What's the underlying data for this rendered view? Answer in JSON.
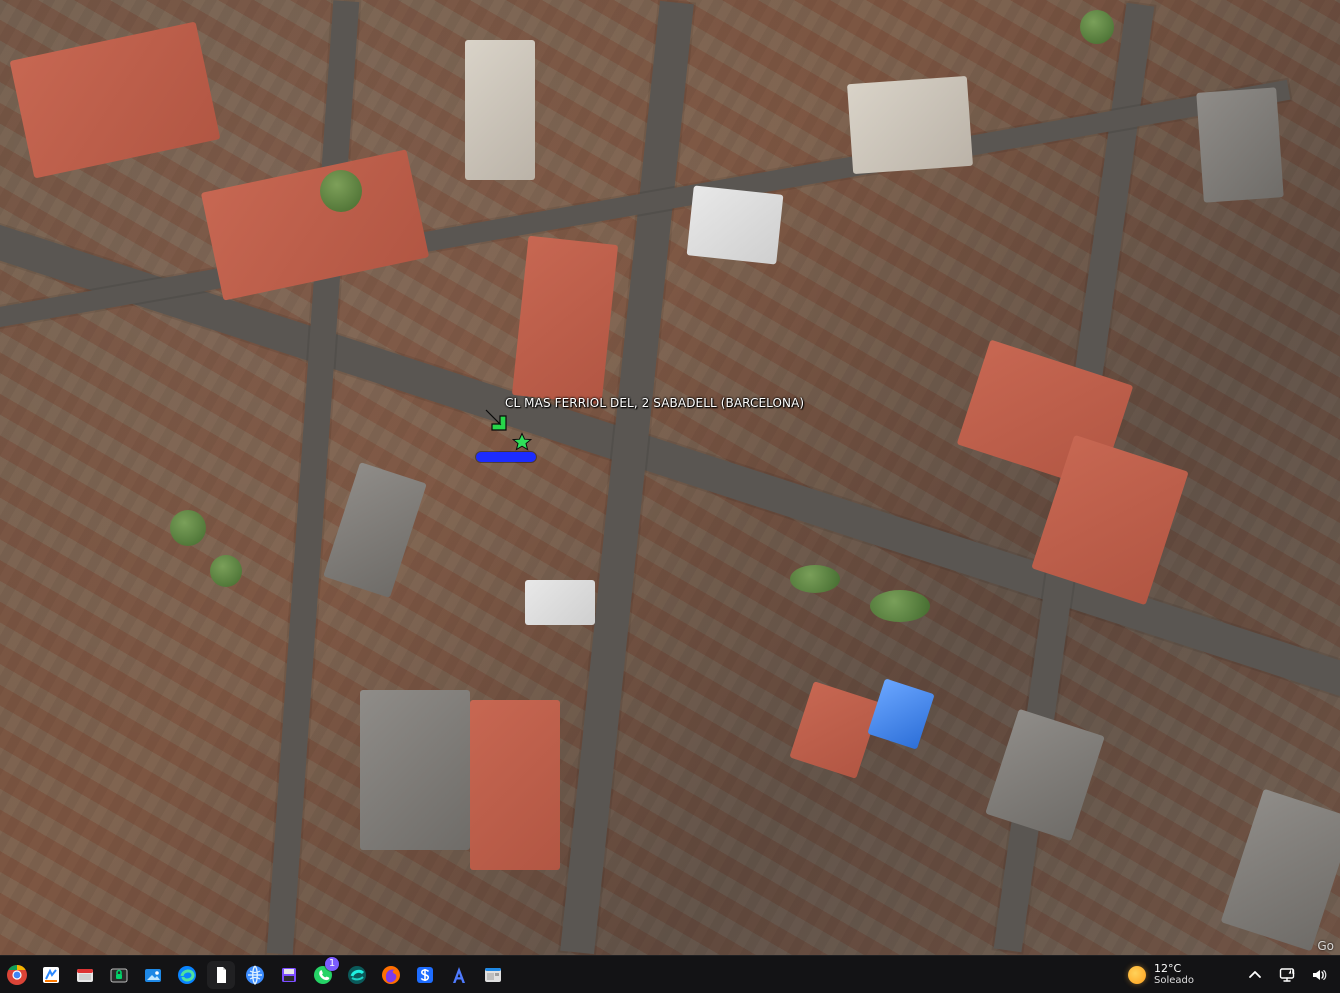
{
  "map": {
    "location_label": "CL MAS FERRIOL DEL, 2  SABADELL (BARCELONA)",
    "attribution_partial": "Go"
  },
  "taskbar": {
    "apps": [
      {
        "name": "chrome-icon",
        "badge": ""
      },
      {
        "name": "whiteboard-icon",
        "badge": ""
      },
      {
        "name": "file-explorer-icon",
        "badge": ""
      },
      {
        "name": "lock-window-icon",
        "badge": ""
      },
      {
        "name": "photos-icon",
        "badge": ""
      },
      {
        "name": "edge-icon",
        "badge": ""
      },
      {
        "name": "document-icon",
        "badge": ""
      },
      {
        "name": "globe-icon",
        "badge": ""
      },
      {
        "name": "save-disk-icon",
        "badge": ""
      },
      {
        "name": "whatsapp-icon",
        "badge": "1"
      },
      {
        "name": "app-sparkle-icon",
        "badge": ""
      },
      {
        "name": "firefox-icon",
        "badge": ""
      },
      {
        "name": "dollar-app-icon",
        "badge": ""
      },
      {
        "name": "a-app-icon",
        "badge": ""
      },
      {
        "name": "window-app-icon",
        "badge": ""
      }
    ],
    "weather": {
      "temp": "12°C",
      "desc": "Soleado"
    }
  }
}
